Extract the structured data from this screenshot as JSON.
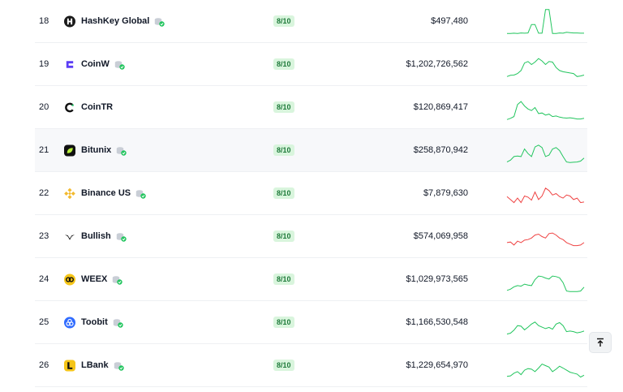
{
  "score_color": "#d9f5dd",
  "up_color": "#22c55e",
  "down_color": "#ef4444",
  "rows": [
    {
      "rank": "18",
      "name": "HashKey Global",
      "score": "8/10",
      "volume": "$497,480",
      "trend": "up",
      "spark": [
        10,
        10,
        11,
        10,
        12,
        11,
        12,
        40,
        40,
        11,
        11,
        90,
        90,
        10,
        10,
        12,
        11,
        14,
        13,
        12,
        12,
        11,
        11
      ]
    },
    {
      "rank": "19",
      "name": "CoinW",
      "score": "8/10",
      "volume": "$1,202,726,562",
      "trend": "up",
      "spark": [
        10,
        14,
        15,
        20,
        30,
        55,
        60,
        50,
        58,
        70,
        62,
        50,
        60,
        58,
        40,
        30,
        26,
        24,
        22,
        20,
        10,
        12,
        15
      ]
    },
    {
      "rank": "20",
      "name": "CoinTR",
      "score": "8/10",
      "volume": "$120,869,417",
      "trend": "up",
      "spark": [
        10,
        14,
        20,
        60,
        70,
        55,
        45,
        40,
        50,
        30,
        32,
        25,
        28,
        20,
        22,
        18,
        16,
        15,
        16,
        14,
        12,
        12,
        14
      ]
    },
    {
      "rank": "21",
      "name": "Bitunix",
      "score": "8/10",
      "volume": "$258,870,942",
      "trend": "up",
      "spark": [
        12,
        18,
        30,
        32,
        30,
        55,
        40,
        30,
        62,
        68,
        60,
        30,
        35,
        55,
        60,
        50,
        30,
        12,
        10,
        11,
        12,
        15,
        25
      ]
    },
    {
      "rank": "22",
      "name": "Binance US",
      "score": "8/10",
      "volume": "$7,879,630",
      "trend": "down",
      "spark": [
        40,
        30,
        20,
        35,
        20,
        42,
        38,
        28,
        55,
        30,
        42,
        68,
        60,
        45,
        50,
        40,
        35,
        45,
        42,
        30,
        35,
        20,
        22
      ]
    },
    {
      "rank": "23",
      "name": "Bullish",
      "score": "8/10",
      "volume": "$574,069,958",
      "trend": "down",
      "spark": [
        30,
        32,
        22,
        35,
        30,
        38,
        40,
        45,
        55,
        58,
        50,
        45,
        60,
        62,
        55,
        45,
        40,
        30,
        25,
        20,
        20,
        22,
        30
      ]
    },
    {
      "rank": "24",
      "name": "WEEX",
      "score": "8/10",
      "volume": "$1,029,973,565",
      "trend": "up",
      "spark": [
        14,
        18,
        26,
        30,
        28,
        35,
        32,
        30,
        50,
        62,
        60,
        55,
        52,
        62,
        60,
        56,
        40,
        12,
        10,
        10,
        10,
        12,
        25
      ]
    },
    {
      "rank": "25",
      "name": "Toobit",
      "score": "8/10",
      "volume": "$1,166,530,548",
      "trend": "up",
      "spark": [
        12,
        15,
        25,
        40,
        38,
        26,
        35,
        45,
        52,
        40,
        35,
        30,
        34,
        28,
        45,
        50,
        40,
        20,
        22,
        20,
        16,
        18,
        22
      ]
    },
    {
      "rank": "26",
      "name": "LBank",
      "score": "8/10",
      "volume": "$1,229,654,970",
      "trend": "up",
      "spark": [
        14,
        16,
        25,
        30,
        20,
        35,
        40,
        38,
        30,
        42,
        55,
        50,
        45,
        30,
        38,
        48,
        42,
        35,
        28,
        25,
        22,
        12,
        18
      ]
    }
  ]
}
